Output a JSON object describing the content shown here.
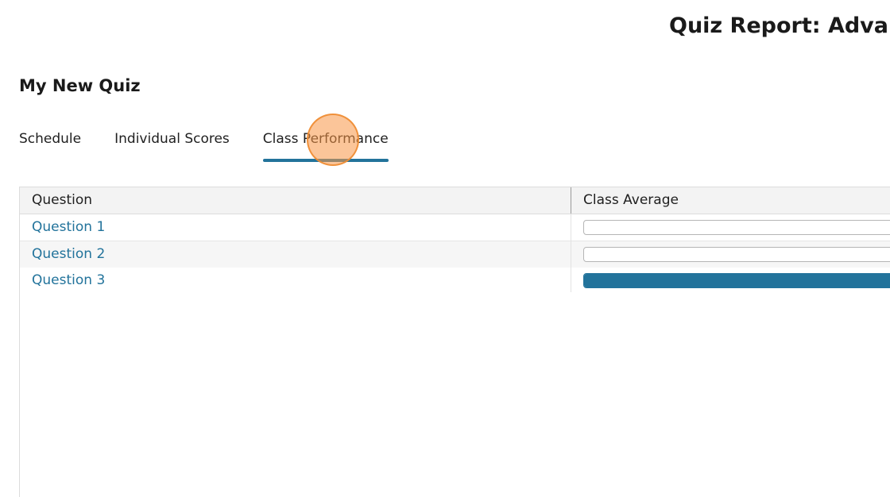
{
  "header": {
    "title": "Quiz Report: Advanc"
  },
  "quiz": {
    "name": "My New Quiz"
  },
  "tabs": [
    {
      "label": "Schedule",
      "active": false
    },
    {
      "label": "Individual Scores",
      "active": false
    },
    {
      "label": "Class Performance",
      "active": true
    }
  ],
  "table": {
    "columns": [
      "Question",
      "Class Average"
    ],
    "rows": [
      {
        "question": "Question 1",
        "class_average_fraction": 0.0
      },
      {
        "question": "Question 2",
        "class_average_fraction": 0.0
      },
      {
        "question": "Question 3",
        "class_average_fraction": 1.0
      }
    ]
  },
  "colors": {
    "accent": "#22739b",
    "click_indicator": "#f79646"
  }
}
